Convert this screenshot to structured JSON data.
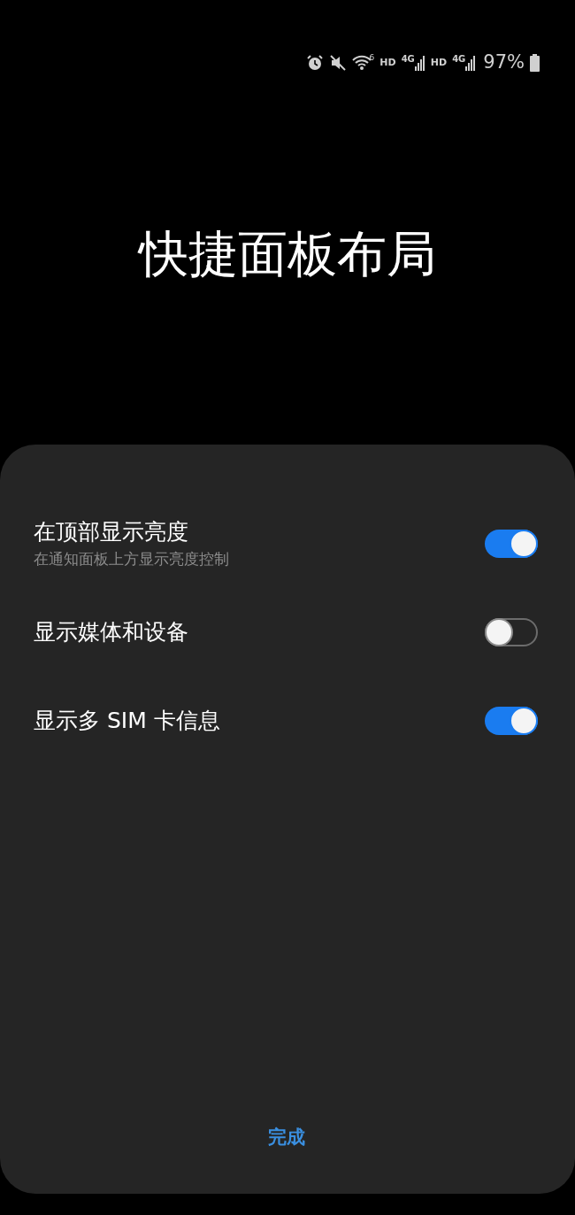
{
  "status_bar": {
    "wifi_badge": "6",
    "network_labels": [
      {
        "hd": "HD",
        "gen": "4G"
      },
      {
        "hd": "HD",
        "gen": "4G"
      }
    ],
    "battery": "97%"
  },
  "title": "快捷面板布局",
  "settings": [
    {
      "label": "在顶部显示亮度",
      "description": "在通知面板上方显示亮度控制",
      "on": true
    },
    {
      "label": "显示媒体和设备",
      "on": false
    },
    {
      "label": "显示多 SIM 卡信息",
      "on": true
    }
  ],
  "done_button": "完成"
}
